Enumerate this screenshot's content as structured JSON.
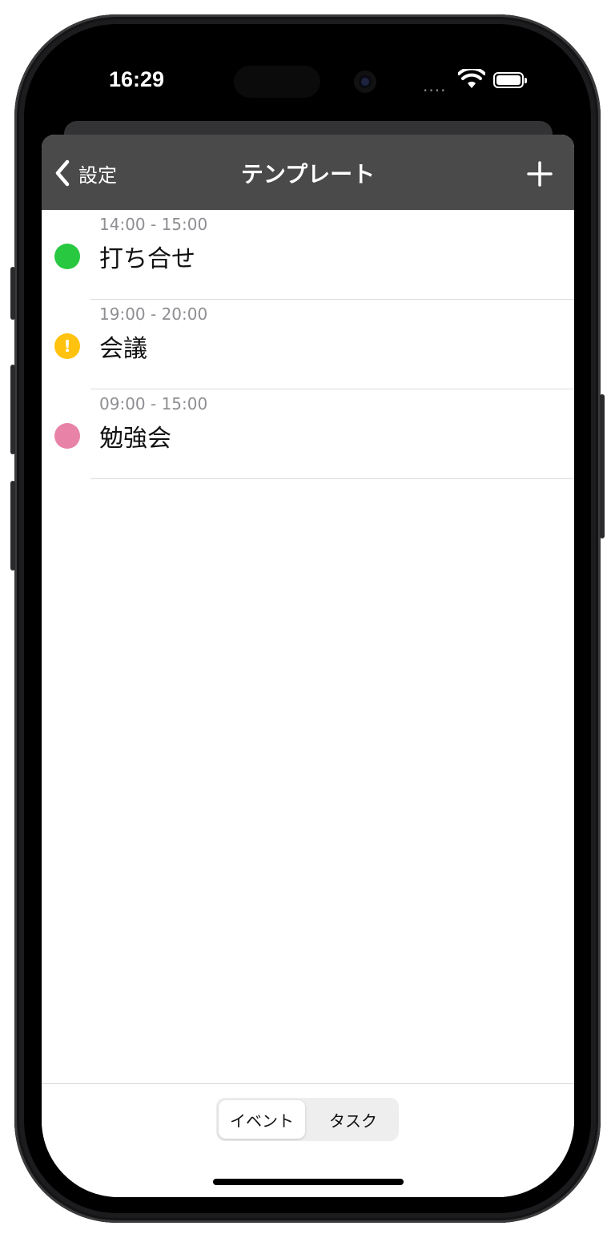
{
  "status_bar": {
    "time": "16:29",
    "signal": "....",
    "battery_icon": "battery-full-icon",
    "wifi_icon": "wifi-icon"
  },
  "nav": {
    "back_label": "設定",
    "back_icon": "chevron-left-icon",
    "title": "テンプレート",
    "add_icon": "plus-icon"
  },
  "templates": [
    {
      "time": "14:00 - 15:00",
      "title": "打ち合せ",
      "color": "#28c840",
      "icon": "status-dot-icon"
    },
    {
      "time": "19:00 - 20:00",
      "title": "会議",
      "color": "#ffc20e",
      "icon": "exclamation-dot-icon",
      "badge": "!"
    },
    {
      "time": "09:00 - 15:00",
      "title": "勉強会",
      "color": "#e882a7",
      "icon": "status-dot-icon"
    }
  ],
  "segments": {
    "active": "イベント",
    "inactive": "タスク"
  },
  "colors": {
    "nav_background": "#4a4a4a",
    "background": "#ffffff",
    "accent_text": "#ffffff"
  }
}
